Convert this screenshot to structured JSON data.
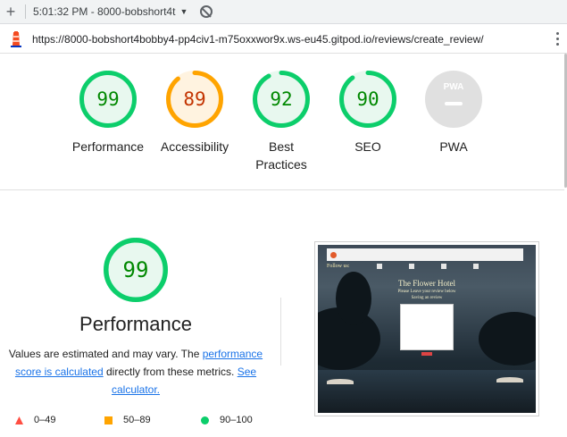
{
  "toolbar": {
    "session": "5:01:32 PM - 8000-bobshort4t"
  },
  "url": "https://8000-bobshort4bobby4-pp4civ1-m75oxxwor9x.ws-eu45.gitpod.io/reviews/create_review/",
  "gauges": [
    {
      "label": "Performance",
      "score": "99",
      "value": 99,
      "color": "#0cce6b",
      "text_color": "#008800",
      "fill": "#e8f8ef"
    },
    {
      "label": "Accessibility",
      "score": "89",
      "value": 89,
      "color": "#ffa400",
      "text_color": "#c33300",
      "fill": "#fff3e0"
    },
    {
      "label": "Best Practices",
      "score": "92",
      "value": 92,
      "color": "#0cce6b",
      "text_color": "#008800",
      "fill": "#e8f8ef"
    },
    {
      "label": "SEO",
      "score": "90",
      "value": 90,
      "color": "#0cce6b",
      "text_color": "#008800",
      "fill": "#e8f8ef"
    },
    {
      "label": "PWA",
      "badge": "PWA"
    }
  ],
  "performance": {
    "score": "99",
    "value": 99,
    "title": "Performance",
    "disclaimer_1": "Values are estimated and may vary. The ",
    "link_1": "performance score is calculated",
    "disclaimer_2": " directly from these metrics. ",
    "link_2": "See calculator."
  },
  "legend": [
    {
      "range": "0–49",
      "shape": "triangle",
      "color": "#ff4e42"
    },
    {
      "range": "50–89",
      "shape": "square",
      "color": "#ffa400"
    },
    {
      "range": "90–100",
      "shape": "circle",
      "color": "#0cce6b"
    }
  ],
  "thumbnail": {
    "follow": "Follow us:",
    "hotel": "The Flower Hotel",
    "line1": "Please Leave your review below",
    "line2": "Saving an review"
  }
}
